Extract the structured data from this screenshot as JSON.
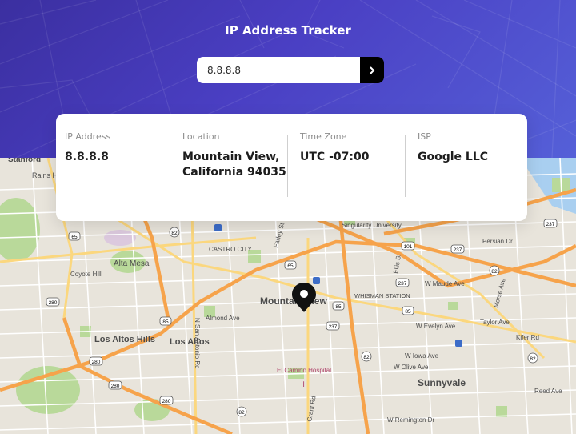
{
  "header": {
    "title": "IP Address Tracker",
    "search_value": "8.8.8.8",
    "submit_icon": "chevron-right-icon"
  },
  "info": {
    "ip": {
      "label": "IP Address",
      "value": "8.8.8.8"
    },
    "location": {
      "label": "Location",
      "line1": "Mountain View,",
      "line2": "California 94035"
    },
    "timezone": {
      "label": "Time Zone",
      "value": "UTC -07:00"
    },
    "isp": {
      "label": "ISP",
      "value": "Google LLC"
    }
  },
  "map": {
    "marker_icon": "location-pin-icon",
    "places": {
      "stanford": "Stanford",
      "rains": "Rains H",
      "alta_mesa": "Alta Mesa",
      "coyote_hill": "Coyote Hill",
      "los_altos_hills": "Los Altos Hills",
      "los_altos": "Los Altos",
      "almond_ave": "Almond Ave",
      "castro_city": "CASTRO CITY",
      "san_antonio": "N San Antonio Rd",
      "mountain_view": "Mountain View",
      "whisman_station": "WHISMAN\nSTATION",
      "ellis_st": "Ellis St",
      "w_maude_ave": "W Maude Ave",
      "w_evelyn_ave": "W Evelyn Ave",
      "w_iowa_ave": "W Iowa Ave",
      "w_olive_ave": "W Olive Ave",
      "sunnyvale": "Sunnyvale",
      "singularity": "Singularity University",
      "persian_dr": "Persian Dr",
      "mathilda": "N Mathilda Ave",
      "morse_ave": "Morse Ave",
      "taylor_ave": "Taylor Ave",
      "kifer_rd": "Kifer Rd",
      "reed_ave": "Reed Ave",
      "el_camino_hospital": "El Camino Hospital",
      "w_remington": "W Remington Dr",
      "farley": "Farley St",
      "grant_rd": "Grant Rd"
    },
    "shields": {
      "s237a": "237",
      "s237b": "237",
      "s237c": "237",
      "s101a": "101",
      "s101b": "101",
      "s82a": "82",
      "s82b": "82",
      "s82c": "82",
      "s82d": "82",
      "s82e": "82",
      "s85": "85",
      "s85b": "85",
      "s280a": "280",
      "s280b": "280",
      "s280c": "280",
      "s280d": "280",
      "s65": "65",
      "s65b": "65",
      "s85c": "85",
      "s237d": "237"
    },
    "colors": {
      "land": "#e8e4db",
      "park": "#b9d99a",
      "highway": "#f6a34b",
      "arterial": "#fbd77e",
      "water": "#a9cff0"
    }
  }
}
